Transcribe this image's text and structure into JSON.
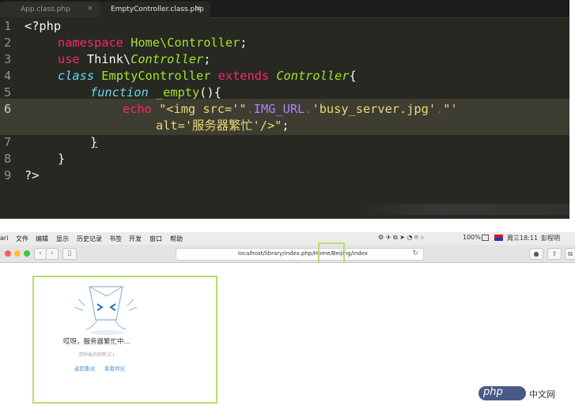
{
  "editor": {
    "tabs": [
      {
        "label": "App.class.php",
        "close": "×"
      },
      {
        "label": "EmptyController.class.php",
        "close": "×"
      }
    ],
    "line_numbers": [
      "1",
      "2",
      "3",
      "4",
      "5",
      "6",
      "",
      "7",
      "8",
      "9"
    ],
    "code": {
      "l1": "<?php",
      "l2_kw": "namespace",
      "l2_ns": "Home\\Controller",
      "l2_end": ";",
      "l3_kw": "use",
      "l3_a": "Think\\",
      "l3_b": "Controller",
      "l3_end": ";",
      "l4_kw": "class",
      "l4_name": "EmptyController",
      "l4_ext": "extends",
      "l4_parent": "Controller",
      "l4_end": "{",
      "l5_kw": "function",
      "l5_name": "_empty",
      "l5_end": "(){",
      "l6_kw": "echo",
      "l6_s1": "\"<img src='\"",
      "l6_dot1": ".",
      "l6_const": "IMG_URL",
      "l6_dot2": ".",
      "l6_s2": "'busy_server.jpg'",
      "l6_dot3": ".",
      "l6_s3": "\"'",
      "l6b_s": "alt='服务器繁忙'/>\"",
      "l6b_end": ";",
      "l7": "}",
      "l8": "}",
      "l9": "?>"
    }
  },
  "browser": {
    "menu": [
      "ari",
      "文件",
      "编辑",
      "显示",
      "历史记录",
      "书签",
      "开发",
      "窗口",
      "帮助"
    ],
    "status": {
      "battery": "100%",
      "datetime": "周三18:11",
      "user": "彭程明"
    },
    "url": "localhost/library/index.php/Home/Beijing/index",
    "page": {
      "message": "哎呀，服务器繁忙中...",
      "sub": "请稍候后刷新试↓",
      "link_back": "返回重试",
      "link_other": "看看师兄"
    }
  },
  "watermark": {
    "logo": "php",
    "text": "中文网"
  },
  "colors": {
    "editor_bg": "#272822",
    "highlight_frame": "#b7dd6d",
    "link": "#4a8fd0"
  }
}
